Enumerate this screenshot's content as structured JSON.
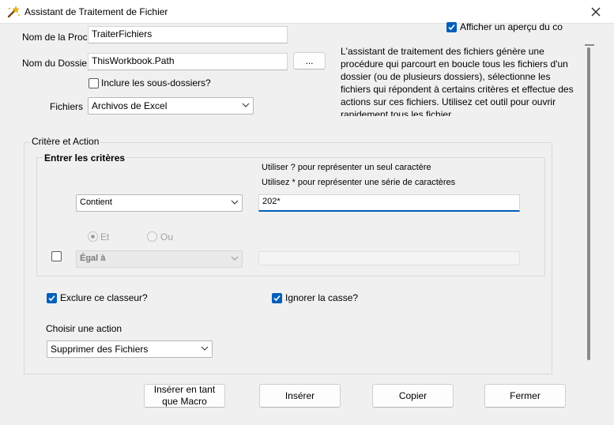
{
  "window": {
    "title": "Assistant de Traitement de Fichier"
  },
  "form": {
    "proc_label": "Nom de la Procé",
    "proc_value": "TraiterFichiers",
    "folder_label": "Nom du Dossier",
    "folder_value": "ThisWorkbook.Path",
    "browse_label": "...",
    "include_sub_label": "Inclure les sous-dossiers?",
    "include_sub_checked": false,
    "files_label": "Fichiers",
    "files_value": "Archivos de Excel",
    "preview_label": "Afficher un aperçu du co",
    "preview_checked": true,
    "description": "L'assistant de traitement des fichiers génère une procédure qui parcourt en boucle tous les fichiers d'un dossier (ou de plusieurs dossiers), sélectionne les fichiers qui répondent à certains critères et effectue des actions sur ces fichiers. Utilisez cet outil pour ouvrir rapidement tous les fichier"
  },
  "criteria": {
    "group_label": "Critère et Action",
    "enter_label": "Entrer les critères",
    "hint1": "Utiliser ? pour représenter un seul caractère",
    "hint2": "Utilisez * pour représenter une série de caractères",
    "op1_value": "Contient",
    "val1_value": "202*",
    "and_label": "Et",
    "or_label": "Ou",
    "op2_value": "Égal à",
    "val2_value": "",
    "exclude_label": "Exclure ce classeur?",
    "exclude_checked": true,
    "ignore_case_label": "Ignorer la casse?",
    "ignore_case_checked": true,
    "action_label": "Choisir une action",
    "action_value": "Supprimer des Fichiers"
  },
  "buttons": {
    "insert_macro_line1": "Insérer en tant",
    "insert_macro_line2": "que Macro",
    "insert": "Insérer",
    "copy": "Copier",
    "close": "Fermer"
  },
  "icons": {
    "app": "wizard-wand-icon",
    "close": "close-icon",
    "dropdown": "chevron-down-icon",
    "check": "checkmark-icon"
  }
}
